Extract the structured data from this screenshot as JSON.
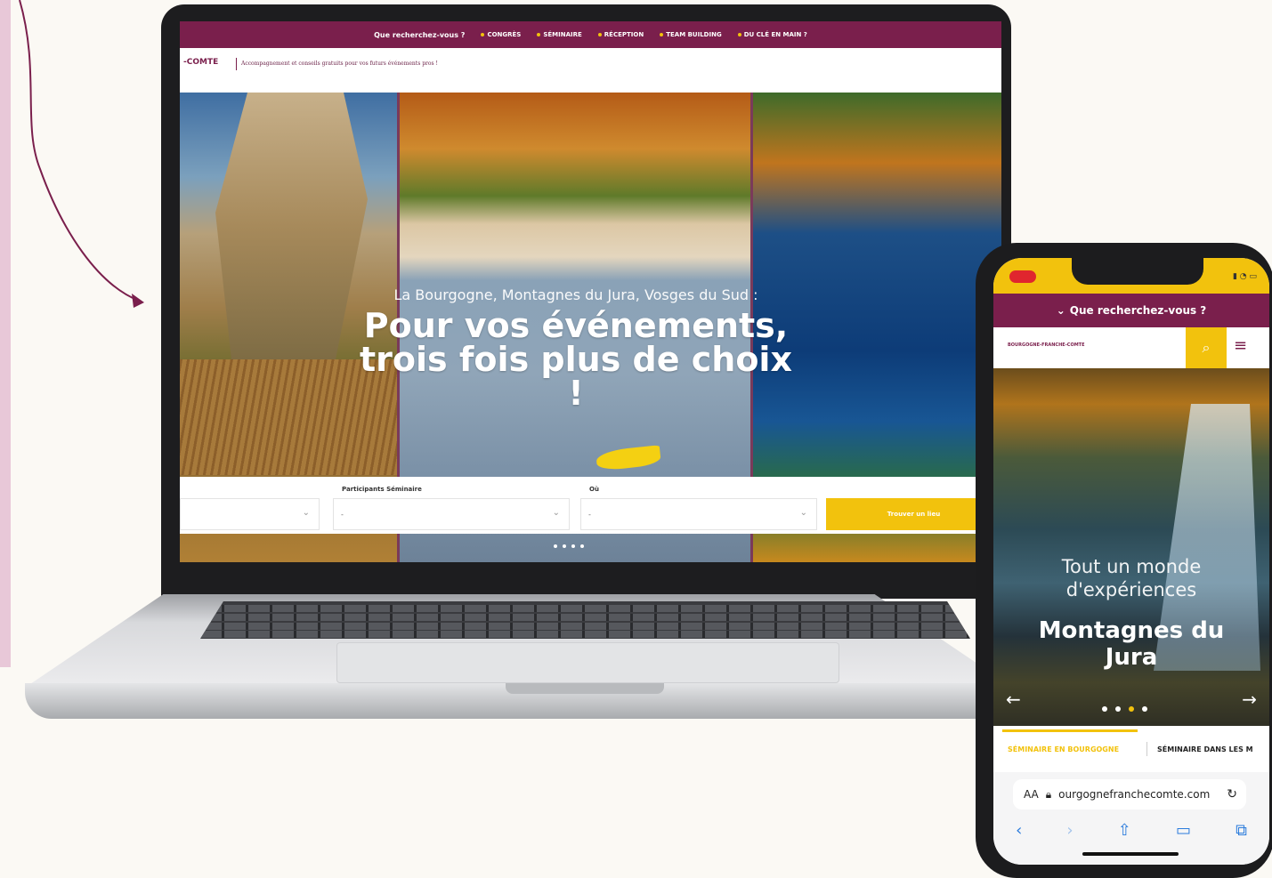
{
  "laptop": {
    "topnav": {
      "question": "Que recherchez-vous ?",
      "items": [
        "CONGRÈS",
        "SÉMINAIRE",
        "RÉCEPTION",
        "TEAM BUILDING",
        "DU CLÉ EN MAIN ?"
      ]
    },
    "logo_fragment": "-COMTE",
    "tagline": "Accompagnement et conseils gratuits pour vos futurs événements pros !",
    "hero": {
      "subtitle": "La Bourgogne, Montagnes du Jura, Vosges du Sud :",
      "title": "Pour vos événements, trois fois plus de choix !"
    },
    "search": {
      "participants_label": "Participants Séminaire",
      "participants_value": "-",
      "where_label": "Où",
      "where_value": "-",
      "first_value": "",
      "button": "Trouver un lieu"
    }
  },
  "phone": {
    "nav_question": "Que recherchez-vous ?",
    "logo": "BOURGOGNE-FRANCHE-COMTE",
    "hero": {
      "subtitle": "Tout un monde d'expériences",
      "title": "Montagnes du Jura"
    },
    "tabs": [
      "SÉMINAIRE EN BOURGOGNE",
      "SÉMINAIRE DANS LES M"
    ],
    "browser": {
      "text_size": "AA",
      "url": "ourgognefranchecomte.com"
    }
  },
  "colors": {
    "brand": "#7a1f4c",
    "accent": "#f2c20d"
  },
  "icons": [
    "arrow-annotation-icon",
    "chevron-down-icon",
    "search-icon",
    "hamburger-menu-icon",
    "arrow-left-icon",
    "arrow-right-icon",
    "lock-icon",
    "reload-icon",
    "share-icon",
    "bookmarks-icon",
    "tabs-icon"
  ]
}
